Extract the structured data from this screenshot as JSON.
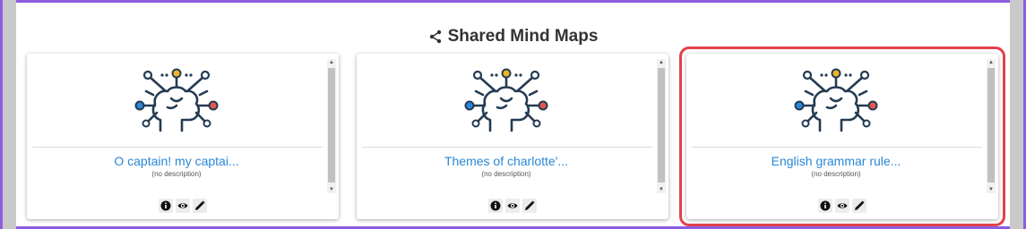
{
  "section": {
    "title": "Shared Mind Maps",
    "icon": "share-icon"
  },
  "cards": [
    {
      "title": "O captain! my captai...",
      "description": "(no description)"
    },
    {
      "title": "Themes of charlotte'...",
      "description": "(no description)"
    },
    {
      "title": "English grammar rule...",
      "description": "(no description)"
    }
  ],
  "icons": {
    "thumbnail": "brain-network-icon",
    "info": "info-icon",
    "view": "eye-icon",
    "edit": "pencil-icon"
  },
  "colors": {
    "link": "#2a86d6",
    "highlight": "#e4404c",
    "node_blue": "#2a86d6",
    "node_yellow": "#f0b429",
    "node_red": "#e4574c",
    "ink": "#243b53"
  }
}
